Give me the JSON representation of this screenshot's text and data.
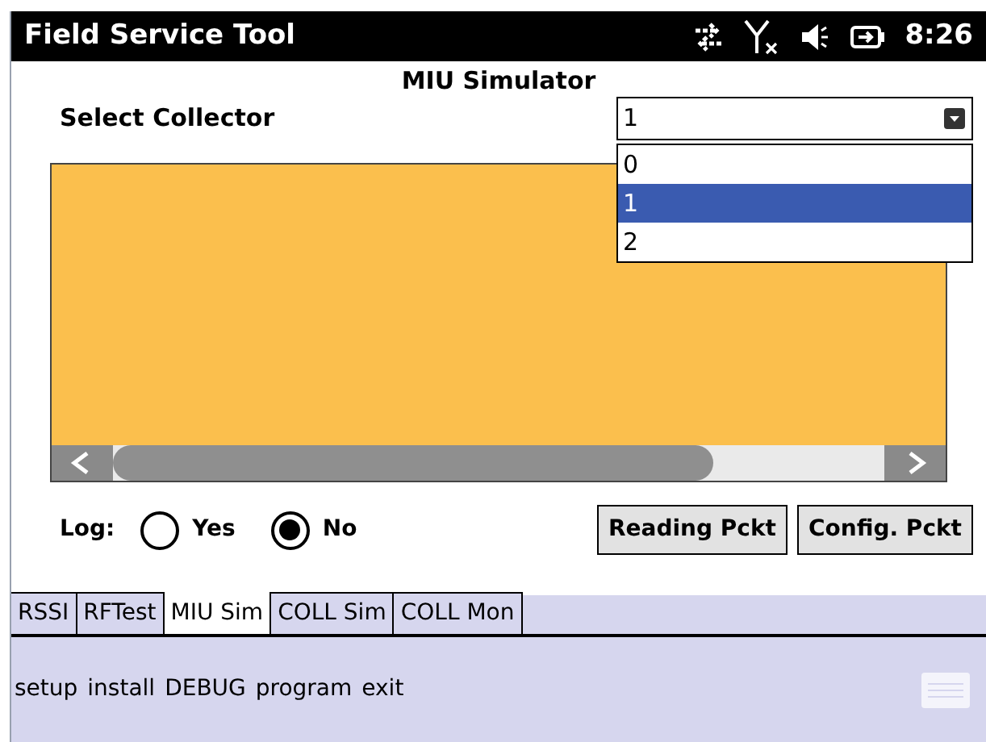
{
  "title_bar": {
    "title": "Field Service Tool",
    "time": "8:26"
  },
  "heading": "MIU Simulator",
  "collector": {
    "label": "Select Collector",
    "value": "1",
    "expanded": true,
    "options": [
      {
        "label": "0",
        "selected": false
      },
      {
        "label": "1",
        "selected": true
      },
      {
        "label": "2",
        "selected": false
      }
    ]
  },
  "log": {
    "label": "Log:",
    "options": [
      {
        "label": "Yes",
        "selected": false
      },
      {
        "label": "No",
        "selected": true
      }
    ]
  },
  "buttons": [
    "Reading Pckt",
    "Config. Pckt"
  ],
  "tabs": [
    {
      "label": "RSSI",
      "selected": false
    },
    {
      "label": "RFTest",
      "selected": false
    },
    {
      "label": "MIU Sim",
      "selected": true
    },
    {
      "label": "COLL Sim",
      "selected": false
    },
    {
      "label": "COLL Mon",
      "selected": false
    }
  ],
  "menu": [
    "setup",
    "install",
    "DEBUG",
    "program",
    "exit"
  ]
}
